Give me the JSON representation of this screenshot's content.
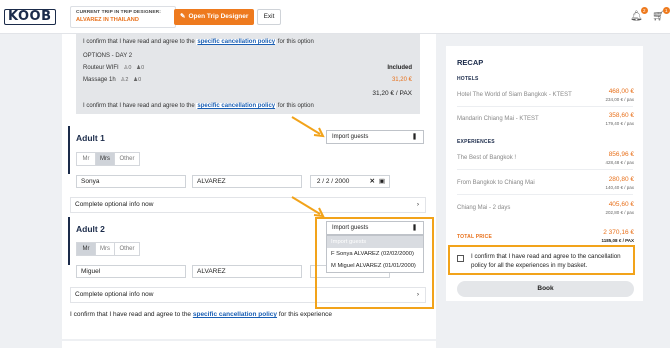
{
  "topbar": {
    "logo": "KOOB",
    "trip_caption": "CURRENT TRIP IN TRIP DESIGNER:",
    "trip_name": "ALVAREZ IN THAILAND",
    "open_label": "Open Trip Designer",
    "exit_label": "Exit",
    "notif_count": "2",
    "cart_count": "1"
  },
  "options": {
    "confirm_prefix": "I confirm that I have read and agree to the",
    "confirm_link": "specific cancellation policy",
    "confirm_suffix": "for this option",
    "day_label": "OPTIONS - DAY 2",
    "rows": [
      {
        "name": "Routeur WIFI",
        "adults": "0",
        "kids": "0",
        "price": "Included"
      },
      {
        "name": "Massage 1h",
        "adults": "2",
        "kids": "0",
        "price": "31,20 €"
      }
    ],
    "total": "31,20 € / PAX"
  },
  "adult1": {
    "title": "Adult 1",
    "civility": [
      "Mr",
      "Mrs",
      "Other"
    ],
    "first_name": "Sonya",
    "last_name": "ALVAREZ",
    "dob_day": "2",
    "dob_month": "2",
    "dob_year": "2000",
    "import_label": "Import guests",
    "optional": "Complete optional info now"
  },
  "adult2": {
    "title": "Adult 2",
    "civility": [
      "Mr",
      "Mrs",
      "Other"
    ],
    "first_name": "Miguel",
    "last_name": "ALVAREZ",
    "dob_year": "2000",
    "import_label": "Import guests",
    "dropdown": [
      "Import guests",
      "F Sonya ALVAREZ (02/02/2000)",
      "M Miguel ALVAREZ (01/01/2000)"
    ],
    "optional": "Complete optional info now"
  },
  "experience_confirm": {
    "prefix": "I confirm that I have read and agree to the",
    "link": "specific cancellation policy",
    "suffix": "for this experience"
  },
  "recap": {
    "title": "RECAP",
    "hotels_label": "HOTELS",
    "hotels": [
      {
        "name": "Hotel The World of Siam Bangkok - KTEST",
        "price": "468,00 €",
        "pax": "234,00 € / pax"
      },
      {
        "name": "Mandarin Chiang Mai - KTEST",
        "price": "358,60 €",
        "pax": "179,40 € / pax"
      }
    ],
    "experiences_label": "EXPERIENCES",
    "experiences": [
      {
        "name": "The Best of Bangkok !",
        "price": "856,96 €",
        "pax": "428,48 € / pax"
      },
      {
        "name": "From Bangkok to Chiang Mai",
        "price": "280,80 €",
        "pax": "140,40 € / pax"
      },
      {
        "name": "Chiang Mai - 2 days",
        "price": "405,60 €",
        "pax": "202,80 € / pax"
      }
    ],
    "total_label": "TOTAL PRICE",
    "total_price": "2 370,16 €",
    "total_pax": "1185,08 € / PAX",
    "checkbox_text": "I confirm that I have read and agree to the cancellation policy for all the experiences in my basket.",
    "book_label": "Book"
  },
  "colors": {
    "accent": "#ee7a1e",
    "highlight": "#f2a31a",
    "navy": "#1b2b4a",
    "link": "#1a5fb4"
  }
}
